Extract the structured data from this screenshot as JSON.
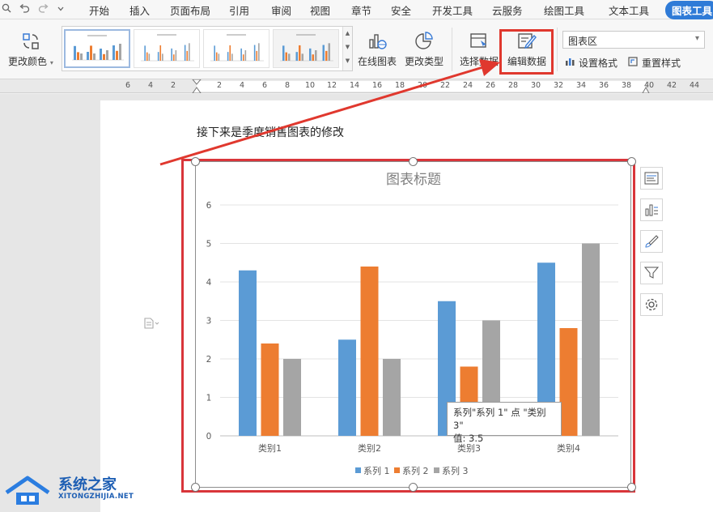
{
  "menubar": {
    "items": [
      "开始",
      "插入",
      "页面布局",
      "引用",
      "审阅",
      "视图",
      "章节",
      "安全",
      "开发工具",
      "云服务",
      "绘图工具",
      "文本工具",
      "图表工具"
    ],
    "active_index": 12
  },
  "ribbon": {
    "change_color": "更改颜色",
    "online_chart": "在线图表",
    "change_type": "更改类型",
    "select_data": "选择数据",
    "edit_data": "编辑数据",
    "chart_area_select": "图表区",
    "set_format": "设置格式",
    "reset_style": "重置样式"
  },
  "ruler": {
    "ticks": [
      "6",
      "4",
      "2",
      "2",
      "4",
      "6",
      "8",
      "10",
      "12",
      "14",
      "16",
      "18",
      "20",
      "22",
      "24",
      "26",
      "28",
      "30",
      "32",
      "34",
      "36",
      "38",
      "40",
      "42",
      "44"
    ]
  },
  "document": {
    "paragraph": "接下来是季度销售图表的修改"
  },
  "tooltip": {
    "line1": "系列\"系列 1\" 点 \"类别3\"",
    "line2": "值: 3.5"
  },
  "watermark": {
    "brand": "系统之家",
    "url": "XITONGZHIJIA.NET"
  },
  "colors": {
    "series1": "#5b9bd5",
    "series2": "#ed7d31",
    "series3": "#a5a5a5",
    "highlight": "#e0382e",
    "accent": "#2f7bd7"
  },
  "chart_data": {
    "type": "bar",
    "title": "图表标题",
    "categories": [
      "类别1",
      "类别2",
      "类别3",
      "类别4"
    ],
    "series": [
      {
        "name": "系列 1",
        "values": [
          4.3,
          2.5,
          3.5,
          4.5
        ]
      },
      {
        "name": "系列 2",
        "values": [
          2.4,
          4.4,
          1.8,
          2.8
        ]
      },
      {
        "name": "系列 3",
        "values": [
          2,
          2,
          3,
          5
        ]
      }
    ],
    "ylim": [
      0,
      6
    ],
    "yticks": [
      "0",
      "1",
      "2",
      "3",
      "4",
      "5",
      "6"
    ],
    "grid": true,
    "legend": "bottom"
  }
}
